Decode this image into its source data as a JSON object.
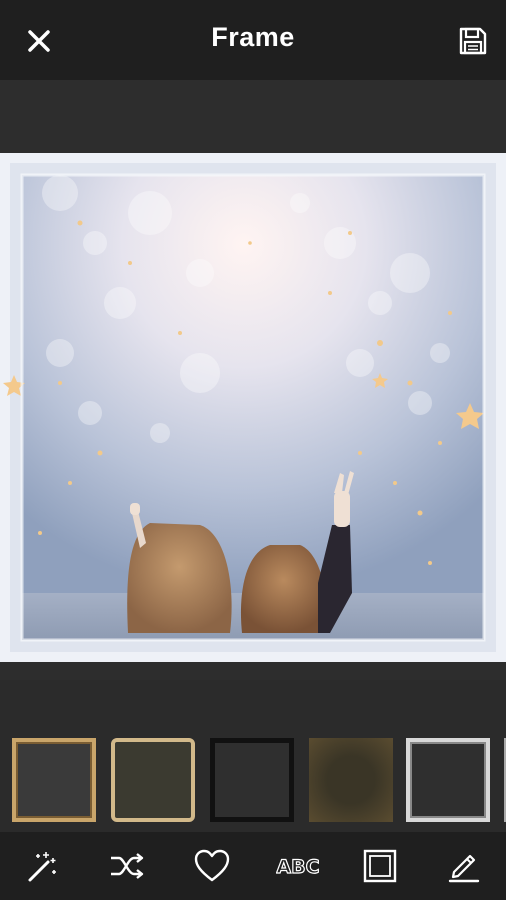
{
  "header": {
    "title": "Frame",
    "close_icon": "close-icon",
    "save_icon": "save-icon"
  },
  "frames": [
    {
      "name": "frame-gold-ornate",
      "selected": true,
      "color": "#c9a56a"
    },
    {
      "name": "frame-gold-octagon",
      "selected": false,
      "color": "#d2b98a"
    },
    {
      "name": "frame-dark-grunge",
      "selected": false,
      "color": "#111111"
    },
    {
      "name": "frame-sepia-vignette",
      "selected": false,
      "color": "#5a4c30"
    },
    {
      "name": "frame-white-border",
      "selected": false,
      "color": "#d8d8d8"
    }
  ],
  "toolbar": {
    "tools": [
      "magic-wand-icon",
      "shuffle-icon",
      "heart-icon",
      "abc-text-icon",
      "square-frame-icon",
      "pencil-icon"
    ],
    "text_tool_label": "ABC"
  },
  "colors": {
    "topbar": "#1f1f1f",
    "background": "#2b2b2b",
    "icon": "#ffffff"
  }
}
